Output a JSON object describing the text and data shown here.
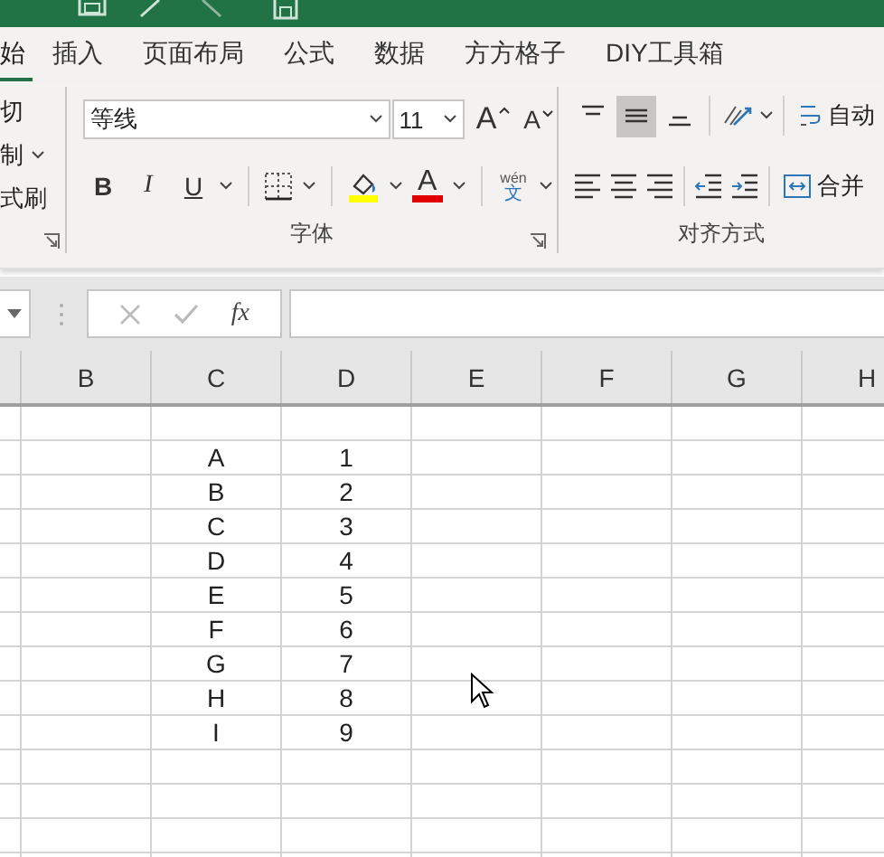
{
  "tabs": [
    {
      "label": "始",
      "selected": true
    },
    {
      "label": "插入",
      "selected": false
    },
    {
      "label": "页面布局",
      "selected": false
    },
    {
      "label": "公式",
      "selected": false
    },
    {
      "label": "数据",
      "selected": false
    },
    {
      "label": "方方格子",
      "selected": false
    },
    {
      "label": "DIY工具箱",
      "selected": false
    }
  ],
  "clipboard": {
    "items": [
      {
        "label": "切",
        "kind": "command"
      },
      {
        "label": "制",
        "kind": "menu"
      },
      {
        "label": "式刷",
        "kind": "command"
      }
    ]
  },
  "font": {
    "name": "等线",
    "size": "11",
    "grow_label": "A",
    "shrink_label": "A",
    "styles": [
      "B",
      "I",
      "U"
    ],
    "font_color_label": "A",
    "phonetic_top": "wén",
    "phonetic_bottom": "文",
    "group_label": "字体"
  },
  "alignment": {
    "vertical": [
      {
        "selected": false
      },
      {
        "selected": true
      },
      {
        "selected": false
      }
    ],
    "wrap_label": "自动",
    "merge_label": "合并",
    "group_label": "对齐方式"
  },
  "formula_bar": {
    "function_label": "fx"
  },
  "sheet": {
    "columns": [
      "B",
      "C",
      "D",
      "E",
      "F",
      "G",
      "H"
    ],
    "rows": [
      {
        "c": "A",
        "d": "1"
      },
      {
        "c": "B",
        "d": "2"
      },
      {
        "c": "C",
        "d": "3"
      },
      {
        "c": "D",
        "d": "4"
      },
      {
        "c": "E",
        "d": "5"
      },
      {
        "c": "F",
        "d": "6"
      },
      {
        "c": "G",
        "d": "7"
      },
      {
        "c": "H",
        "d": "8"
      },
      {
        "c": "I",
        "d": "9"
      }
    ]
  }
}
